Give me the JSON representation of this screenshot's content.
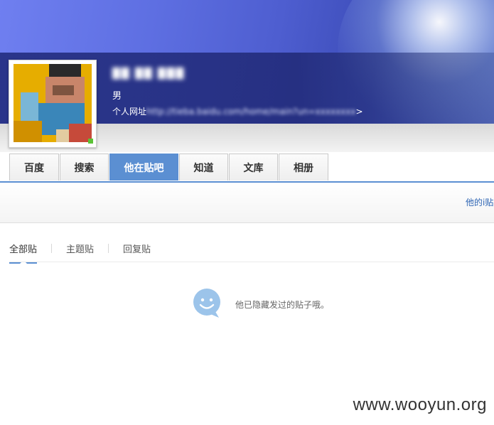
{
  "profile": {
    "username": "██ ██ ███",
    "gender": "男",
    "website_label": "个人网址",
    "website_url": "http://tieba.baidu.com/home/main?un=xxxxxxxx",
    "website_suffix": ">"
  },
  "nav_tabs": [
    {
      "label": "百度",
      "active": false
    },
    {
      "label": "搜索",
      "active": false
    },
    {
      "label": "他在贴吧",
      "active": true
    },
    {
      "label": "知道",
      "active": false
    },
    {
      "label": "文库",
      "active": false
    },
    {
      "label": "相册",
      "active": false
    }
  ],
  "subbar": {
    "right_link": "他的i贴"
  },
  "post_filters": [
    {
      "label": "全部贴",
      "active": true
    },
    {
      "label": "主题贴",
      "active": false
    },
    {
      "label": "回复贴",
      "active": false
    }
  ],
  "empty_state": {
    "message": "他已隐藏发过的贴子哦。",
    "icon": "smiley-chat-icon"
  },
  "watermark": "www.wooyun.org",
  "colors": {
    "accent": "#5b8fd2",
    "link": "#2d64b3",
    "online": "#5bc236"
  }
}
